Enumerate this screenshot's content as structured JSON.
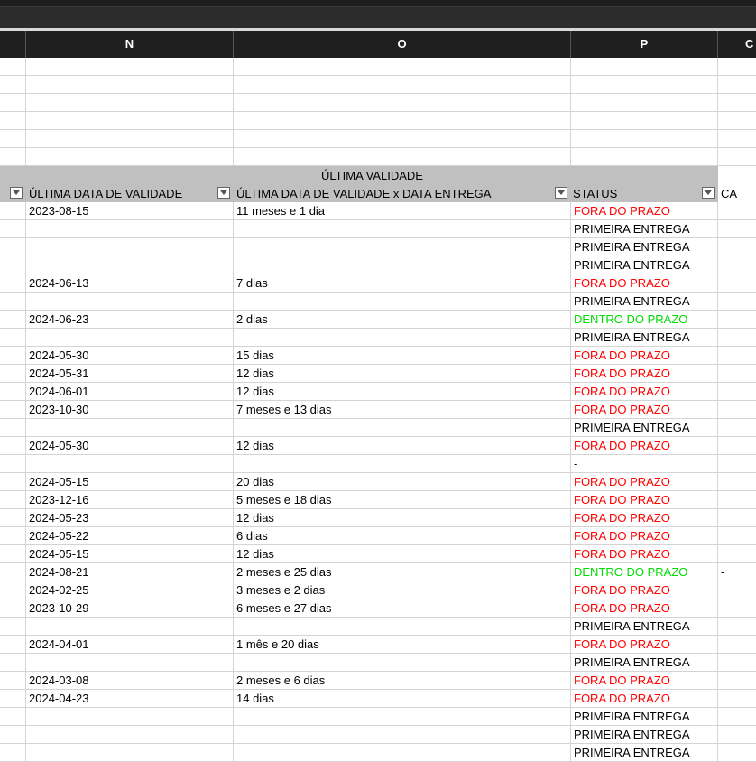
{
  "columns": {
    "n": "N",
    "o": "O",
    "p": "P",
    "q": "C"
  },
  "table": {
    "group_title": "ÚLTIMA VALIDADE",
    "headers": {
      "last_date": "ÚLTIMA DATA DE VALIDADE",
      "diff": "ÚLTIMA DATA DE VALIDADE x DATA ENTREGA",
      "status": "STATUS",
      "next": "CA"
    },
    "rows": [
      {
        "date": "2023-08-15",
        "diff": "11 meses e 1 dia",
        "status": "FORA DO PRAZO",
        "kind": "red",
        "extra": ""
      },
      {
        "date": "",
        "diff": "",
        "status": "PRIMEIRA ENTREGA",
        "kind": "black",
        "extra": ""
      },
      {
        "date": "",
        "diff": "",
        "status": "PRIMEIRA ENTREGA",
        "kind": "black",
        "extra": ""
      },
      {
        "date": "",
        "diff": "",
        "status": "PRIMEIRA ENTREGA",
        "kind": "black",
        "extra": ""
      },
      {
        "date": "2024-06-13",
        "diff": "7 dias",
        "status": "FORA DO PRAZO",
        "kind": "red",
        "extra": ""
      },
      {
        "date": "",
        "diff": "",
        "status": "PRIMEIRA ENTREGA",
        "kind": "black",
        "extra": ""
      },
      {
        "date": "2024-06-23",
        "diff": "2 dias",
        "status": "DENTRO DO PRAZO",
        "kind": "green",
        "extra": ""
      },
      {
        "date": "",
        "diff": "",
        "status": "PRIMEIRA ENTREGA",
        "kind": "black",
        "extra": ""
      },
      {
        "date": "2024-05-30",
        "diff": "15 dias",
        "status": "FORA DO PRAZO",
        "kind": "red",
        "extra": ""
      },
      {
        "date": "2024-05-31",
        "diff": "12 dias",
        "status": "FORA DO PRAZO",
        "kind": "red",
        "extra": ""
      },
      {
        "date": "2024-06-01",
        "diff": "12 dias",
        "status": "FORA DO PRAZO",
        "kind": "red",
        "extra": ""
      },
      {
        "date": "2023-10-30",
        "diff": "7 meses e 13 dias",
        "status": "FORA DO PRAZO",
        "kind": "red",
        "extra": ""
      },
      {
        "date": "",
        "diff": "",
        "status": "PRIMEIRA ENTREGA",
        "kind": "black",
        "extra": ""
      },
      {
        "date": "2024-05-30",
        "diff": "12 dias",
        "status": "FORA DO PRAZO",
        "kind": "red",
        "extra": ""
      },
      {
        "date": "",
        "diff": "",
        "status": "-",
        "kind": "black",
        "extra": ""
      },
      {
        "date": "2024-05-15",
        "diff": "20 dias",
        "status": "FORA DO PRAZO",
        "kind": "red",
        "extra": ""
      },
      {
        "date": "2023-12-16",
        "diff": "5 meses e 18 dias",
        "status": "FORA DO PRAZO",
        "kind": "red",
        "extra": ""
      },
      {
        "date": "2024-05-23",
        "diff": "12 dias",
        "status": "FORA DO PRAZO",
        "kind": "red",
        "extra": ""
      },
      {
        "date": "2024-05-22",
        "diff": "6 dias",
        "status": "FORA DO PRAZO",
        "kind": "red",
        "extra": ""
      },
      {
        "date": "2024-05-15",
        "diff": "12 dias",
        "status": "FORA DO PRAZO",
        "kind": "red",
        "extra": ""
      },
      {
        "date": "2024-08-21",
        "diff": "2 meses e 25 dias",
        "status": "DENTRO DO PRAZO",
        "kind": "green",
        "extra": "-"
      },
      {
        "date": "2024-02-25",
        "diff": "3 meses e 2 dias",
        "status": "FORA DO PRAZO",
        "kind": "red",
        "extra": ""
      },
      {
        "date": "2023-10-29",
        "diff": "6 meses e 27 dias",
        "status": "FORA DO PRAZO",
        "kind": "red",
        "extra": ""
      },
      {
        "date": "",
        "diff": "",
        "status": "PRIMEIRA ENTREGA",
        "kind": "black",
        "extra": ""
      },
      {
        "date": "2024-04-01",
        "diff": "1 mês e 20 dias",
        "status": "FORA DO PRAZO",
        "kind": "red",
        "extra": ""
      },
      {
        "date": "",
        "diff": "",
        "status": "PRIMEIRA ENTREGA",
        "kind": "black",
        "extra": ""
      },
      {
        "date": "2024-03-08",
        "diff": "2 meses e 6 dias",
        "status": "FORA DO PRAZO",
        "kind": "red",
        "extra": ""
      },
      {
        "date": "2024-04-23",
        "diff": "14 dias",
        "status": "FORA DO PRAZO",
        "kind": "red",
        "extra": ""
      },
      {
        "date": "",
        "diff": "",
        "status": "PRIMEIRA ENTREGA",
        "kind": "black",
        "extra": ""
      },
      {
        "date": "",
        "diff": "",
        "status": "PRIMEIRA ENTREGA",
        "kind": "black",
        "extra": ""
      },
      {
        "date": "",
        "diff": "",
        "status": "PRIMEIRA ENTREGA",
        "kind": "black",
        "extra": ""
      }
    ]
  },
  "colors": {
    "late": "#ff0000",
    "ontime": "#00dd00",
    "header_bg": "#c0c0c0",
    "col_header_bg": "#1f1f1f"
  },
  "icons": {
    "filter": "filter-dropdown-icon"
  }
}
